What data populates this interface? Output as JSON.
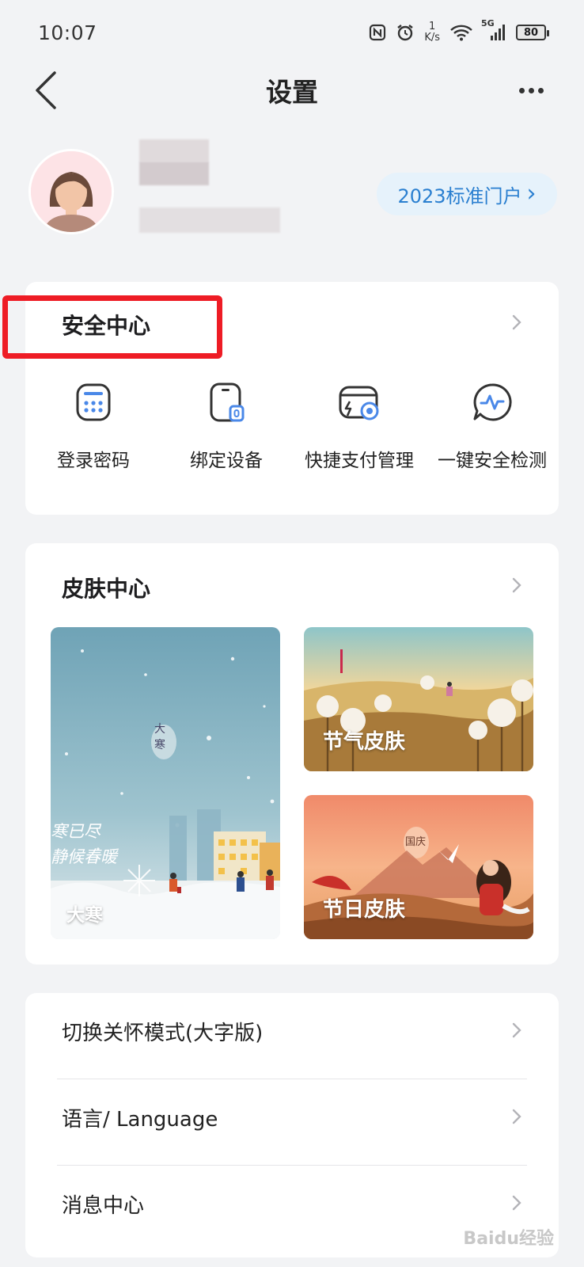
{
  "status_bar": {
    "time": "10:07",
    "net_speed_value": "1",
    "net_speed_unit": "K/s",
    "signal_label": "5G",
    "battery": "80"
  },
  "nav": {
    "title": "设置"
  },
  "profile": {
    "portal_label": "2023标准门户",
    "portal_chevron": "›"
  },
  "security": {
    "title": "安全中心",
    "items": [
      {
        "label": "登录密码",
        "icon": "password-keypad-icon"
      },
      {
        "label": "绑定设备",
        "icon": "bound-device-icon"
      },
      {
        "label": "快捷支付管理",
        "icon": "quick-payment-icon"
      },
      {
        "label": "一键安全检测",
        "icon": "security-check-icon"
      }
    ]
  },
  "skin": {
    "title": "皮肤中心",
    "tiles": [
      {
        "label": "大寒",
        "poster_text_1": "大",
        "poster_text_2": "寒",
        "poster_line_1": "寒已尽",
        "poster_line_2": "静候春暖"
      },
      {
        "label": "节气皮肤"
      },
      {
        "label": "节日皮肤",
        "poster_text": "国庆"
      }
    ]
  },
  "settings_list": [
    {
      "label": "切换关怀模式(大字版)"
    },
    {
      "label": "语言/ Language"
    },
    {
      "label": "消息中心"
    }
  ],
  "watermark": "Baidu经验",
  "colors": {
    "accent": "#2a7fd0",
    "highlight_border": "#ee1c25",
    "background": "#f2f3f5"
  }
}
